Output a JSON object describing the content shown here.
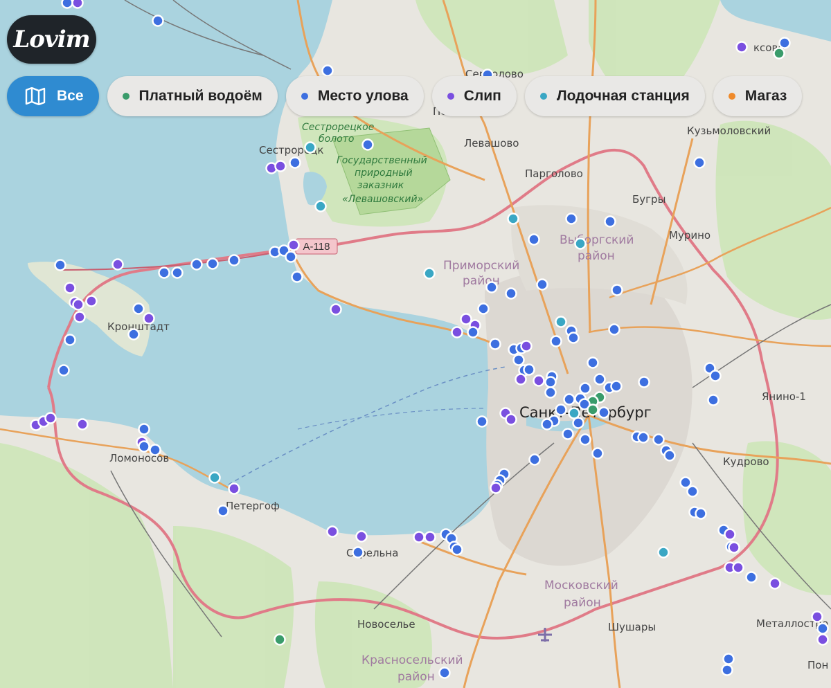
{
  "brand": {
    "logo_text": "Lovim"
  },
  "filters": {
    "all_label": "Все",
    "items": [
      {
        "label": "Платный водоём",
        "color": "#3a9c6b"
      },
      {
        "label": "Место улова",
        "color": "#3d6fe0"
      },
      {
        "label": "Слип",
        "color": "#7a4fe0"
      },
      {
        "label": "Лодочная станция",
        "color": "#3aa7c4"
      },
      {
        "label": "Магаз",
        "color": "#ef8a2a"
      }
    ]
  },
  "map": {
    "road_label": "A-118",
    "places": {
      "kuzmolovsky": "Кузьмоловский",
      "sestroretsk": "Сестрорецк",
      "levashovo": "Левашово",
      "pargolovo": "Парголово",
      "bugry": "Бугры",
      "murino": "Мурино",
      "kronshtadt": "Кронштадт",
      "spb": "Санкт-Петербург",
      "yanino": "Янино-1",
      "kudrovo": "Кудрово",
      "lomonosov": "Ломоносов",
      "peterhof": "Петергоф",
      "strelna": "Стрельна",
      "novoselye": "Новоселье",
      "shushary": "Шушары",
      "metallostroy": "Металлостро",
      "toksovo": "ксово",
      "sertolovo": "Сертолово",
      "pesochny": "Песочн",
      "pon": "Пон"
    },
    "districts": {
      "primorsky_1": "Приморский",
      "primorsky_2": "район",
      "vyborgsky_1": "Выборгский",
      "vyborgsky_2": "район",
      "moskovsky_1": "Московский",
      "moskovsky_2": "район",
      "krasnoselsky_1": "Красносельский",
      "krasnoselsky_2": "район"
    },
    "reserves": {
      "bog_1": "Сестрорецкое",
      "bog_2": "болото",
      "reserve_1": "Государственный",
      "reserve_2": "природный",
      "reserve_3": "заказник",
      "reserve_4": "«Левашовский»"
    }
  }
}
